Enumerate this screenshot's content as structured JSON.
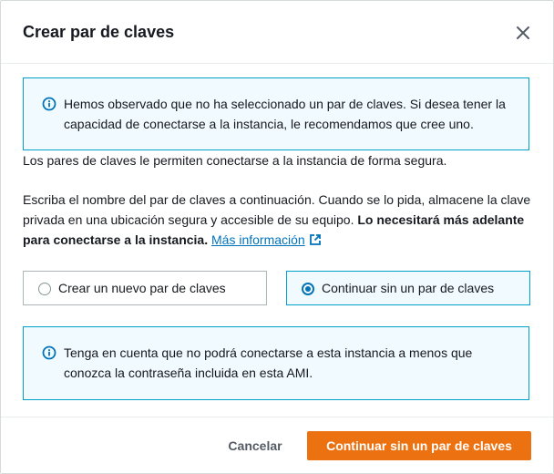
{
  "dialog": {
    "title": "Crear par de claves"
  },
  "info_alert_top": {
    "text": "Hemos observado que no ha seleccionado un par de claves. Si desea tener la capacidad de conectarse a la instancia, le recomendamos que cree uno."
  },
  "description": {
    "p1": "Los pares de claves le permiten conectarse a la instancia de forma segura.",
    "p2_normal": "Escriba el nombre del par de claves a continuación. Cuando se lo pida, almacene la clave privada en una ubicación segura y accesible de su equipo. ",
    "p2_bold": "Lo necesitará más adelante para conectarse a la instancia.",
    "link_text": "Más información"
  },
  "options": [
    {
      "label": "Crear un nuevo par de claves",
      "selected": false
    },
    {
      "label": "Continuar sin un par de claves",
      "selected": true
    }
  ],
  "info_alert_bottom": {
    "text": "Tenga en cuenta que no podrá conectarse a esta instancia a menos que conozca la contraseña incluida en esta AMI."
  },
  "footer": {
    "cancel_label": "Cancelar",
    "primary_label": "Continuar sin un par de claves"
  },
  "colors": {
    "primary": "#ec7211",
    "info_border": "#00a1c9",
    "info_bg": "#f1faff",
    "link": "#0073bb"
  },
  "icons": {
    "close": "close-icon",
    "info": "info-icon",
    "external_link": "external-link-icon"
  }
}
